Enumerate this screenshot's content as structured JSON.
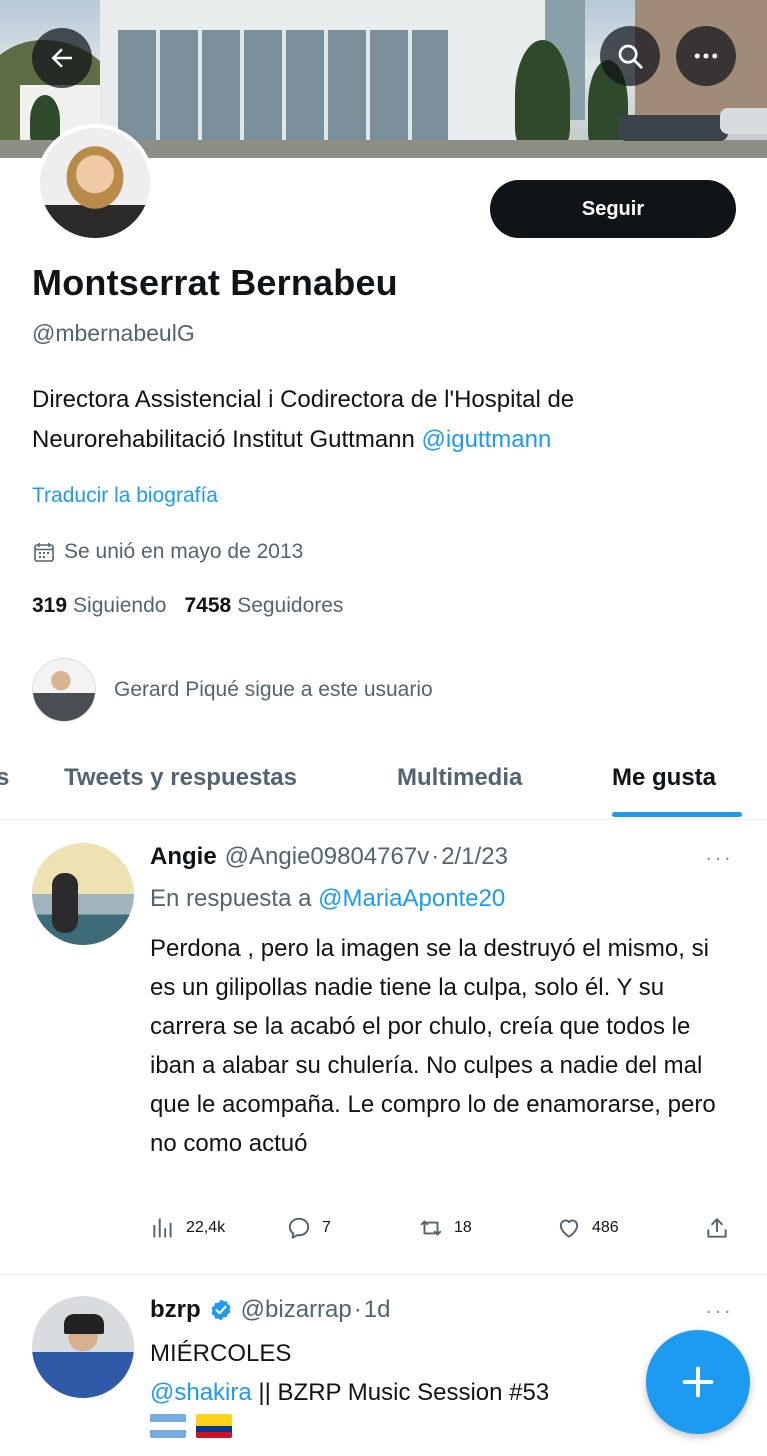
{
  "profile": {
    "name": "Montserrat Bernabeu",
    "handle": "@mbernabeulG",
    "bio_text": "Directora Assistencial i Codirectora de l'Hospital de Neurorehabilitació Institut Guttmann ",
    "bio_mention": "@iguttmann",
    "translate_label": "Traducir la biografía",
    "joined": "Se unió en mayo de 2013",
    "following_count": "319",
    "following_label": "Siguiendo",
    "followers_count": "7458",
    "followers_label": "Seguidores",
    "followed_by": "Gerard Piqué sigue a este usuario",
    "follow_button": "Seguir"
  },
  "icons": {
    "back": "arrow-left-icon",
    "search": "search-icon",
    "more": "more-icon",
    "calendar": "calendar-icon",
    "compose": "plus-icon"
  },
  "tabs": [
    {
      "label": "s"
    },
    {
      "label": "Tweets y respuestas"
    },
    {
      "label": "Multimedia"
    },
    {
      "label": "Me gusta",
      "active": true
    }
  ],
  "tweets": [
    {
      "display_name": "Angie",
      "handle": "@Angie09804767v",
      "dot": "·",
      "date": "2/1/23",
      "reply_prefix": "En respuesta a",
      "reply_to": "@MariaAponte20",
      "body": "Perdona , pero la imagen se la destruyó el mismo, si es un gilipollas nadie tiene la culpa, solo él. Y su carrera se la acabó el por chulo, creía que todos le iban a alabar su chulería. No culpes a nadie del mal que le acompaña. Le compro lo de enamorarse, pero no como actuó",
      "views": "22,4k",
      "replies": "7",
      "retweets": "18",
      "likes": "486"
    },
    {
      "display_name": "bzrp",
      "handle": "@bizarrap",
      "dot": "·",
      "date": "1d",
      "line1": "MIÉRCOLES",
      "mention": "@shakira",
      "line2_rest": " || BZRP Music Session #53"
    }
  ],
  "colors": {
    "accent": "#1d9bf0",
    "text": "#0f1419",
    "secondary": "#536471"
  }
}
